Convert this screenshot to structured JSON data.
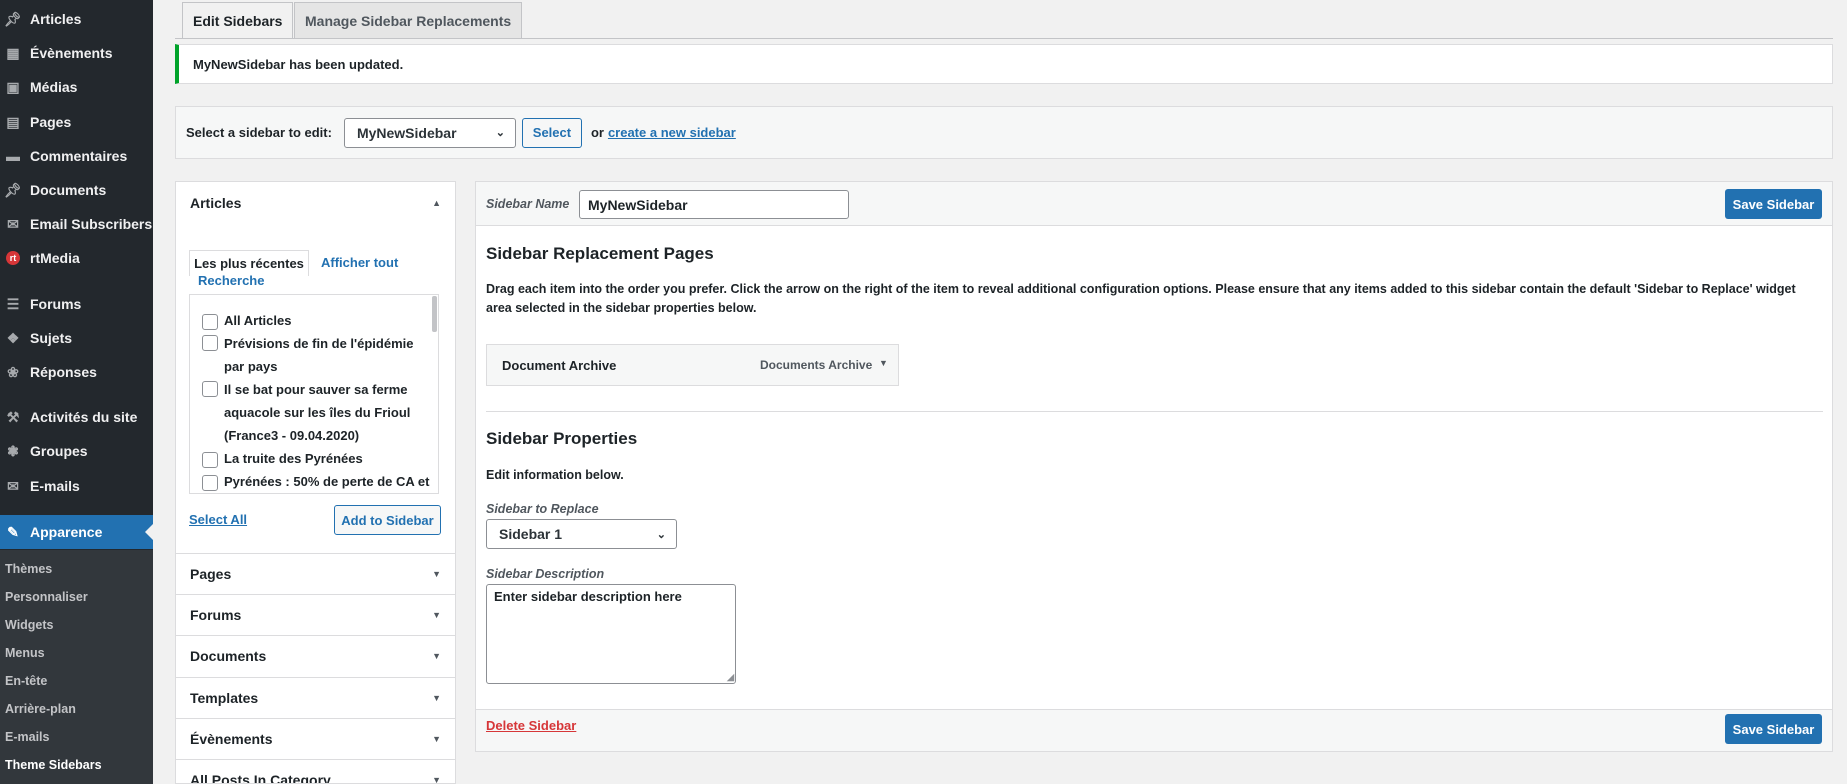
{
  "menu": {
    "articles": "Articles",
    "evenements": "Évènements",
    "medias": "Médias",
    "pages": "Pages",
    "commentaires": "Commentaires",
    "documents": "Documents",
    "email_subscribers": "Email Subscribers",
    "rtmedia": "rtMedia",
    "forums": "Forums",
    "sujets": "Sujets",
    "reponses": "Réponses",
    "activites": "Activités du site",
    "groupes": "Groupes",
    "emails": "E-mails",
    "apparence": "Apparence"
  },
  "submenu": {
    "themes": "Thèmes",
    "personnaliser": "Personnaliser",
    "widgets": "Widgets",
    "menus": "Menus",
    "entete": "En-tête",
    "arriere_plan": "Arrière-plan",
    "emails": "E-mails",
    "theme_sidebars": "Theme Sidebars"
  },
  "tabs": {
    "edit": "Edit Sidebars",
    "manage": "Manage Sidebar Replacements"
  },
  "notice": {
    "text": "MyNewSidebar has been updated."
  },
  "selector": {
    "label": "Select a sidebar to edit:",
    "value": "MyNewSidebar",
    "button": "Select",
    "or": "or",
    "create_link": "create a new sidebar"
  },
  "accordion": {
    "articles": {
      "title": "Articles",
      "tab_recent": "Les plus récentes",
      "tab_all": "Afficher tout",
      "tab_search": "Recherche",
      "items": [
        "All Articles",
        "Prévisions de fin de l'épidémie par pays",
        "Il se bat pour sauver sa ferme aquacole sur les îles du Frioul (France3 - 09.04.2020)",
        "La truite des Pyrénées",
        "Pyrénées : 50% de perte de CA et"
      ],
      "select_all": "Select All",
      "add": "Add to Sidebar"
    },
    "sections": [
      "Pages",
      "Forums",
      "Documents",
      "Templates",
      "Évènements",
      "All Posts In Category"
    ]
  },
  "editor": {
    "name_label": "Sidebar Name",
    "name_value": "MyNewSidebar",
    "save": "Save Sidebar",
    "replacement_title": "Sidebar Replacement Pages",
    "replacement_desc": "Drag each item into the order you prefer. Click the arrow on the right of the item to reveal additional configuration options. Please ensure that any items added to this sidebar contain the default 'Sidebar to Replace' widget area selected in the sidebar properties below.",
    "item_title": "Document Archive",
    "item_type": "Documents Archive",
    "props_title": "Sidebar Properties",
    "props_desc": "Edit information below.",
    "replace_label": "Sidebar to Replace",
    "replace_value": "Sidebar 1",
    "desc_label": "Sidebar Description",
    "desc_placeholder": "Enter sidebar description here",
    "delete": "Delete Sidebar"
  },
  "colors": {
    "menu_bg": "#23282d",
    "accent": "#2271b1",
    "success": "#00a32a",
    "danger": "#d63638"
  }
}
